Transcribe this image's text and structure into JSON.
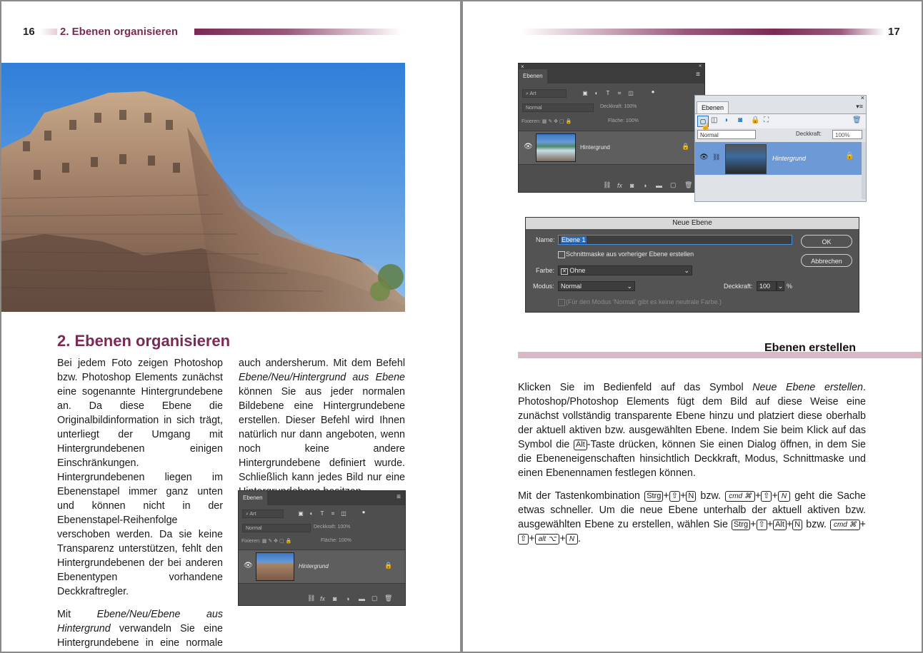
{
  "left_page": {
    "page_number": "16",
    "running_head": "2. Ebenen organisieren",
    "heading": "2. Ebenen organisieren",
    "col1_para1": "Bei jedem Foto zeigen Photoshop bzw. Photoshop Elements zunächst eine sogenannte Hintergrundebene an. Da diese Ebene die Originalbildinformation in sich trägt, unterliegt der Umgang mit Hintergrundebenen einigen Einschränkungen. Hintergrundebenen liegen im Ebenenstapel immer ganz unten und können nicht in der Ebenenstapel-Reihenfolge verschoben werden. Da sie keine Transparenz unterstützen, fehlt den Hintergrundebenen der bei anderen Ebenentypen vorhandene Deckkraftregler.",
    "col1_para2_pre": "Mit ",
    "col1_para2_em": "Ebene/Neu/Ebene aus Hintergrund",
    "col1_para2_post": " verwandeln Sie eine Hintergrundebene in eine normale Bildebene. Es geht aber",
    "col2_pre": "auch andersherum. Mit dem Befehl ",
    "col2_em": "Ebene/Neu/Hintergrund aus Ebene",
    "col2_post": " können Sie aus jeder normalen Bildebene eine Hintergrundebene erstellen. Dieser Befehl wird Ihnen natürlich nur dann angeboten, wenn noch keine andere Hintergrundebene definiert wurde. Schließlich kann jedes Bild nur eine Hintergrundebene besitzen.",
    "panel": {
      "tab": "Ebenen",
      "kind": "Art",
      "mode": "Normal",
      "opacity_label": "Deckkraft:",
      "opacity_value": "100%",
      "lock_label": "Fixieren:",
      "fill_label": "Fläche:",
      "fill_value": "100%",
      "layer_name": "Hintergrund"
    }
  },
  "right_page": {
    "page_number": "17",
    "ps_panel": {
      "tab": "Ebenen",
      "kind": "Art",
      "mode": "Normal",
      "opacity_label": "Deckkraft:",
      "opacity_value": "100%",
      "lock_label": "Fixieren:",
      "fill_label": "Fläche:",
      "fill_value": "100%",
      "layer_name": "Hintergrund"
    },
    "pse_panel": {
      "tab": "Ebenen",
      "mode": "Normal",
      "opacity_label": "Deckkraft:",
      "opacity_value": "100%",
      "layer_name": "Hintergrund"
    },
    "dialog": {
      "title": "Neue Ebene",
      "name_label": "Name:",
      "name_value": "Ebene 1",
      "clip_checkbox": "Schnittmaske aus vorheriger Ebene erstellen",
      "color_label": "Farbe:",
      "color_value": "Ohne",
      "mode_label": "Modus:",
      "mode_value": "Normal",
      "opacity_label": "Deckkraft:",
      "opacity_value": "100",
      "percent": "%",
      "neutral_note": "(Für den Modus 'Normal' gibt es keine neutrale Farbe.)",
      "ok": "OK",
      "cancel": "Abbrechen"
    },
    "section_heading": "Ebenen erstellen",
    "para1_pre": "Klicken Sie im Bedienfeld auf das Symbol ",
    "para1_em": "Neue Ebene erstellen",
    "para1_mid": ". Photoshop/Photoshop Elements fügt dem Bild auf diese Weise eine zunächst vollständig transparente Ebene hinzu und platziert diese oberhalb der aktuell aktiven bzw. ausgewählten Ebene. Indem Sie beim Klick auf das Symbol die ",
    "para1_key": "Alt",
    "para1_post": "-Taste drücken, können Sie einen Dialog öffnen, in dem Sie die Ebeneneigenschaften hinsichtlich Deckkraft, Modus, Schnittmaske und einen Ebenennamen festlegen können.",
    "para2": {
      "t1": "Mit der Tastenkombination ",
      "k_strg": "Strg",
      "k_shift": "⇧",
      "k_n": "N",
      "t_bzw": " bzw. ",
      "k_cmd": "cmd ⌘",
      "k_shift2": "⇧",
      "k_n2": "N",
      "t2": " geht die Sache etwas schneller. Um die neue Ebene unterhalb der aktuell aktiven bzw. ausgewählten Ebene zu erstellen, wählen Sie ",
      "k_strg2": "Strg",
      "k_shift3": "⇧",
      "k_alt": "Alt",
      "k_n3": "N",
      "t_bzw2": " bzw. ",
      "k_cmd2": "cmd ⌘",
      "k_shift4": "⇧",
      "k_alt2": "alt ⌥",
      "k_n4": "N",
      "t_end": "."
    }
  },
  "colors": {
    "accent": "#7a2a55",
    "accent_light": "#d9b8c8"
  }
}
